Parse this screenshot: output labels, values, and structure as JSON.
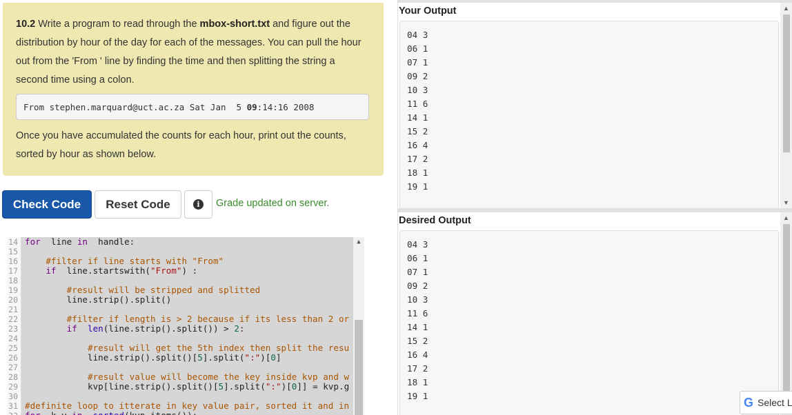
{
  "problem": {
    "number": "10.2",
    "text_before": " Write a program to read through the ",
    "filename": "mbox-short.txt",
    "text_after": " and figure out the distribution by hour of the day for each of the messages. You can pull the hour out from the 'From ' line by finding the time and then splitting the string a second time using a colon.",
    "example_line_pre": "From stephen.marquard@uct.ac.za Sat Jan  5 ",
    "example_line_hour": "09",
    "example_line_post": ":14:16 2008",
    "text_footer": "Once you have accumulated the counts for each hour, print out the counts, sorted by hour as shown below."
  },
  "actions": {
    "check_label": "Check Code",
    "reset_label": "Reset Code",
    "info_icon": "info-icon",
    "grade_message": "Grade updated on server.",
    "grade_color": "#3c8a2e",
    "check_color": "#1958a8"
  },
  "editor": {
    "lines": [
      {
        "n": "14",
        "segs": [
          [
            "kw",
            "for"
          ],
          [
            "",
            "  line "
          ],
          [
            "kw",
            "in"
          ],
          [
            "",
            "  handle:"
          ]
        ]
      },
      {
        "n": "15",
        "segs": []
      },
      {
        "n": "16",
        "segs": [
          [
            "",
            "    "
          ],
          [
            "cm",
            "#filter if line starts with \"From\""
          ]
        ]
      },
      {
        "n": "17",
        "segs": [
          [
            "",
            "    "
          ],
          [
            "kw",
            "if"
          ],
          [
            "",
            "  line.startswith("
          ],
          [
            "st",
            "\"From\""
          ],
          [
            "",
            ") :"
          ]
        ]
      },
      {
        "n": "18",
        "segs": []
      },
      {
        "n": "19",
        "segs": [
          [
            "",
            "        "
          ],
          [
            "cm",
            "#result will be stripped and splitted"
          ]
        ]
      },
      {
        "n": "20",
        "segs": [
          [
            "",
            "        line.strip().split()"
          ]
        ]
      },
      {
        "n": "21",
        "segs": []
      },
      {
        "n": "22",
        "segs": [
          [
            "",
            "        "
          ],
          [
            "cm",
            "#filter if length is > 2 because if its less than 2 or"
          ]
        ]
      },
      {
        "n": "23",
        "segs": [
          [
            "",
            "        "
          ],
          [
            "kw",
            "if"
          ],
          [
            "",
            "  "
          ],
          [
            "bi",
            "len"
          ],
          [
            "",
            "(line.strip().split()) > "
          ],
          [
            "nm",
            "2"
          ],
          [
            "",
            ":"
          ]
        ]
      },
      {
        "n": "24",
        "segs": []
      },
      {
        "n": "25",
        "segs": [
          [
            "",
            "            "
          ],
          [
            "cm",
            "#result will get the 5th index then split the resu"
          ]
        ]
      },
      {
        "n": "26",
        "segs": [
          [
            "",
            "            line.strip().split()["
          ],
          [
            "nm",
            "5"
          ],
          [
            "",
            "].split("
          ],
          [
            "st",
            "\":\""
          ],
          [
            "",
            ")["
          ],
          [
            "nm",
            "0"
          ],
          [
            "",
            "]"
          ]
        ]
      },
      {
        "n": "27",
        "segs": []
      },
      {
        "n": "28",
        "segs": [
          [
            "",
            "            "
          ],
          [
            "cm",
            "#result value will become the key inside kvp and w"
          ]
        ]
      },
      {
        "n": "29",
        "segs": [
          [
            "",
            "            kvp[line.strip().split()["
          ],
          [
            "nm",
            "5"
          ],
          [
            "",
            "].split("
          ],
          [
            "st",
            "\":\""
          ],
          [
            "",
            ")["
          ],
          [
            "nm",
            "0"
          ],
          [
            "",
            "]] = kvp.g"
          ]
        ]
      },
      {
        "n": "30",
        "segs": []
      },
      {
        "n": "31",
        "segs": [
          [
            "cm",
            "#definite loop to itterate in key value pair, sorted it and in"
          ]
        ]
      },
      {
        "n": "32",
        "segs": [
          [
            "kw",
            "for"
          ],
          [
            "",
            "  k,v "
          ],
          [
            "kw",
            "in"
          ],
          [
            "",
            "  "
          ],
          [
            "bi",
            "sorted"
          ],
          [
            "",
            "(kvp.items()):"
          ]
        ]
      }
    ]
  },
  "your_output": {
    "title": "Your Output",
    "lines": [
      "04 3",
      "06 1",
      "07 1",
      "09 2",
      "10 3",
      "11 6",
      "14 1",
      "15 2",
      "16 4",
      "17 2",
      "18 1",
      "19 1"
    ]
  },
  "desired_output": {
    "title": "Desired Output",
    "lines": [
      "04 3",
      "06 1",
      "07 1",
      "09 2",
      "10 3",
      "11 6",
      "14 1",
      "15 2",
      "16 4",
      "17 2",
      "18 1",
      "19 1"
    ]
  },
  "translate": {
    "icon": "google-g-icon",
    "label": "Select L"
  }
}
